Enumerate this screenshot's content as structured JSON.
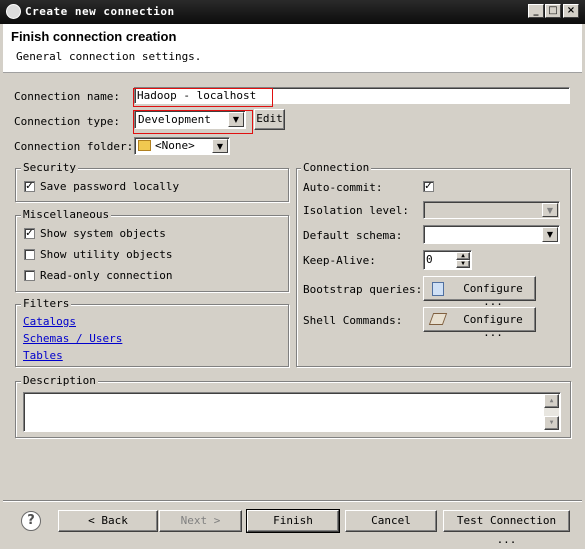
{
  "window": {
    "title": "Create new connection",
    "min": "_",
    "max": "□",
    "close": "×"
  },
  "header": {
    "title": "Finish connection creation",
    "subtitle": "General connection settings."
  },
  "form": {
    "name_label": "Connection name:",
    "name_value": "Hadoop - localhost",
    "type_label": "Connection type:",
    "type_value": "Development",
    "edit_label": "Edit",
    "folder_label": "Connection folder:",
    "folder_value": "<None>"
  },
  "security": {
    "title": "Security",
    "save_password": "Save password locally"
  },
  "misc": {
    "title": "Miscellaneous",
    "show_system": "Show system objects",
    "show_utility": "Show utility objects",
    "read_only": "Read-only connection"
  },
  "filters": {
    "title": "Filters",
    "catalogs": "Catalogs",
    "schemas": "Schemas / Users",
    "tables": "Tables"
  },
  "connection": {
    "title": "Connection",
    "auto_commit": "Auto-commit:",
    "isolation": "Isolation level:",
    "default_schema": "Default schema:",
    "keep_alive": "Keep-Alive:",
    "keep_alive_value": "0",
    "bootstrap": "Bootstrap queries:",
    "shell": "Shell Commands:",
    "configure": "Configure ..."
  },
  "description": {
    "title": "Description"
  },
  "footer": {
    "help": "?",
    "back": "< Back",
    "next": "Next >",
    "finish": "Finish",
    "cancel": "Cancel",
    "test": "Test Connection ..."
  },
  "checks": {
    "save_password": true,
    "show_system": true,
    "show_utility": false,
    "read_only": false,
    "auto_commit": true
  },
  "colors": {
    "title_bar": "#1a1a1a",
    "dialog_bg": "#d4d0c8",
    "link": "#0000cc",
    "highlight_box": "#e01010"
  }
}
